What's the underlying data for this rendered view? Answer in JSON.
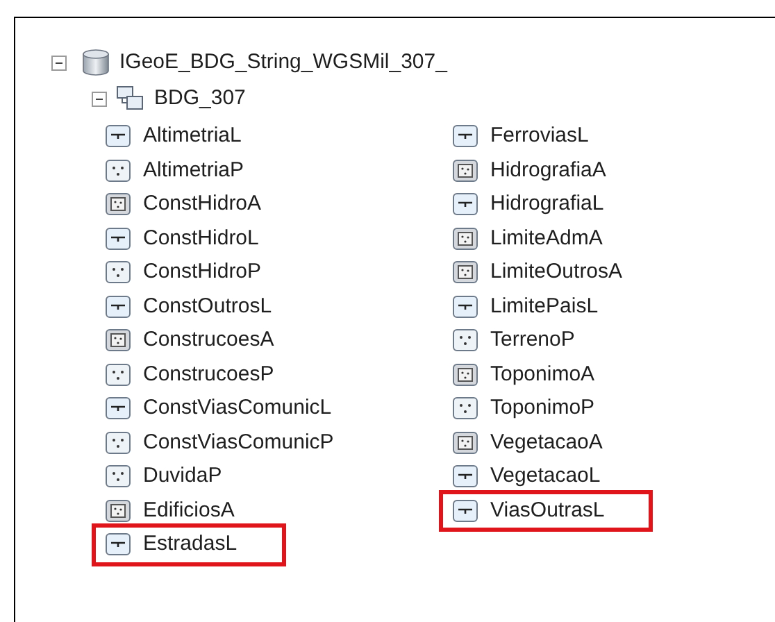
{
  "tree": {
    "label": "IGeoE_BDG_String_WGSMil_307_",
    "expanded": true,
    "children": [
      {
        "label": "BDG_307",
        "expanded": true,
        "children": [
          {
            "label": "AltimetriaL",
            "kind": "line",
            "highlighted": false
          },
          {
            "label": "AltimetriaP",
            "kind": "point",
            "highlighted": false
          },
          {
            "label": "ConstHidroA",
            "kind": "polygon",
            "highlighted": false
          },
          {
            "label": "ConstHidroL",
            "kind": "line",
            "highlighted": false
          },
          {
            "label": "ConstHidroP",
            "kind": "point",
            "highlighted": false
          },
          {
            "label": "ConstOutrosL",
            "kind": "line",
            "highlighted": false
          },
          {
            "label": "ConstrucoesA",
            "kind": "polygon",
            "highlighted": false
          },
          {
            "label": "ConstrucoesP",
            "kind": "point",
            "highlighted": false
          },
          {
            "label": "ConstViasComunicL",
            "kind": "line",
            "highlighted": false
          },
          {
            "label": "ConstViasComunicP",
            "kind": "point",
            "highlighted": false
          },
          {
            "label": "DuvidaP",
            "kind": "point",
            "highlighted": false
          },
          {
            "label": "EdificiosA",
            "kind": "polygon",
            "highlighted": false
          },
          {
            "label": "EstradasL",
            "kind": "line",
            "highlighted": true
          },
          {
            "label": "FerroviasL",
            "kind": "line",
            "highlighted": false
          },
          {
            "label": "HidrografiaA",
            "kind": "polygon",
            "highlighted": false
          },
          {
            "label": "HidrografiaL",
            "kind": "line",
            "highlighted": false
          },
          {
            "label": "LimiteAdmA",
            "kind": "polygon",
            "highlighted": false
          },
          {
            "label": "LimiteOutrosA",
            "kind": "polygon",
            "highlighted": false
          },
          {
            "label": "LimitePaisL",
            "kind": "line",
            "highlighted": false
          },
          {
            "label": "TerrenoP",
            "kind": "point",
            "highlighted": false
          },
          {
            "label": "ToponimoA",
            "kind": "polygon",
            "highlighted": false
          },
          {
            "label": "ToponimoP",
            "kind": "point",
            "highlighted": false
          },
          {
            "label": "VegetacaoA",
            "kind": "polygon",
            "highlighted": false
          },
          {
            "label": "VegetacaoL",
            "kind": "line",
            "highlighted": false
          },
          {
            "label": "ViasOutrasL",
            "kind": "line",
            "highlighted": true
          }
        ]
      }
    ]
  }
}
